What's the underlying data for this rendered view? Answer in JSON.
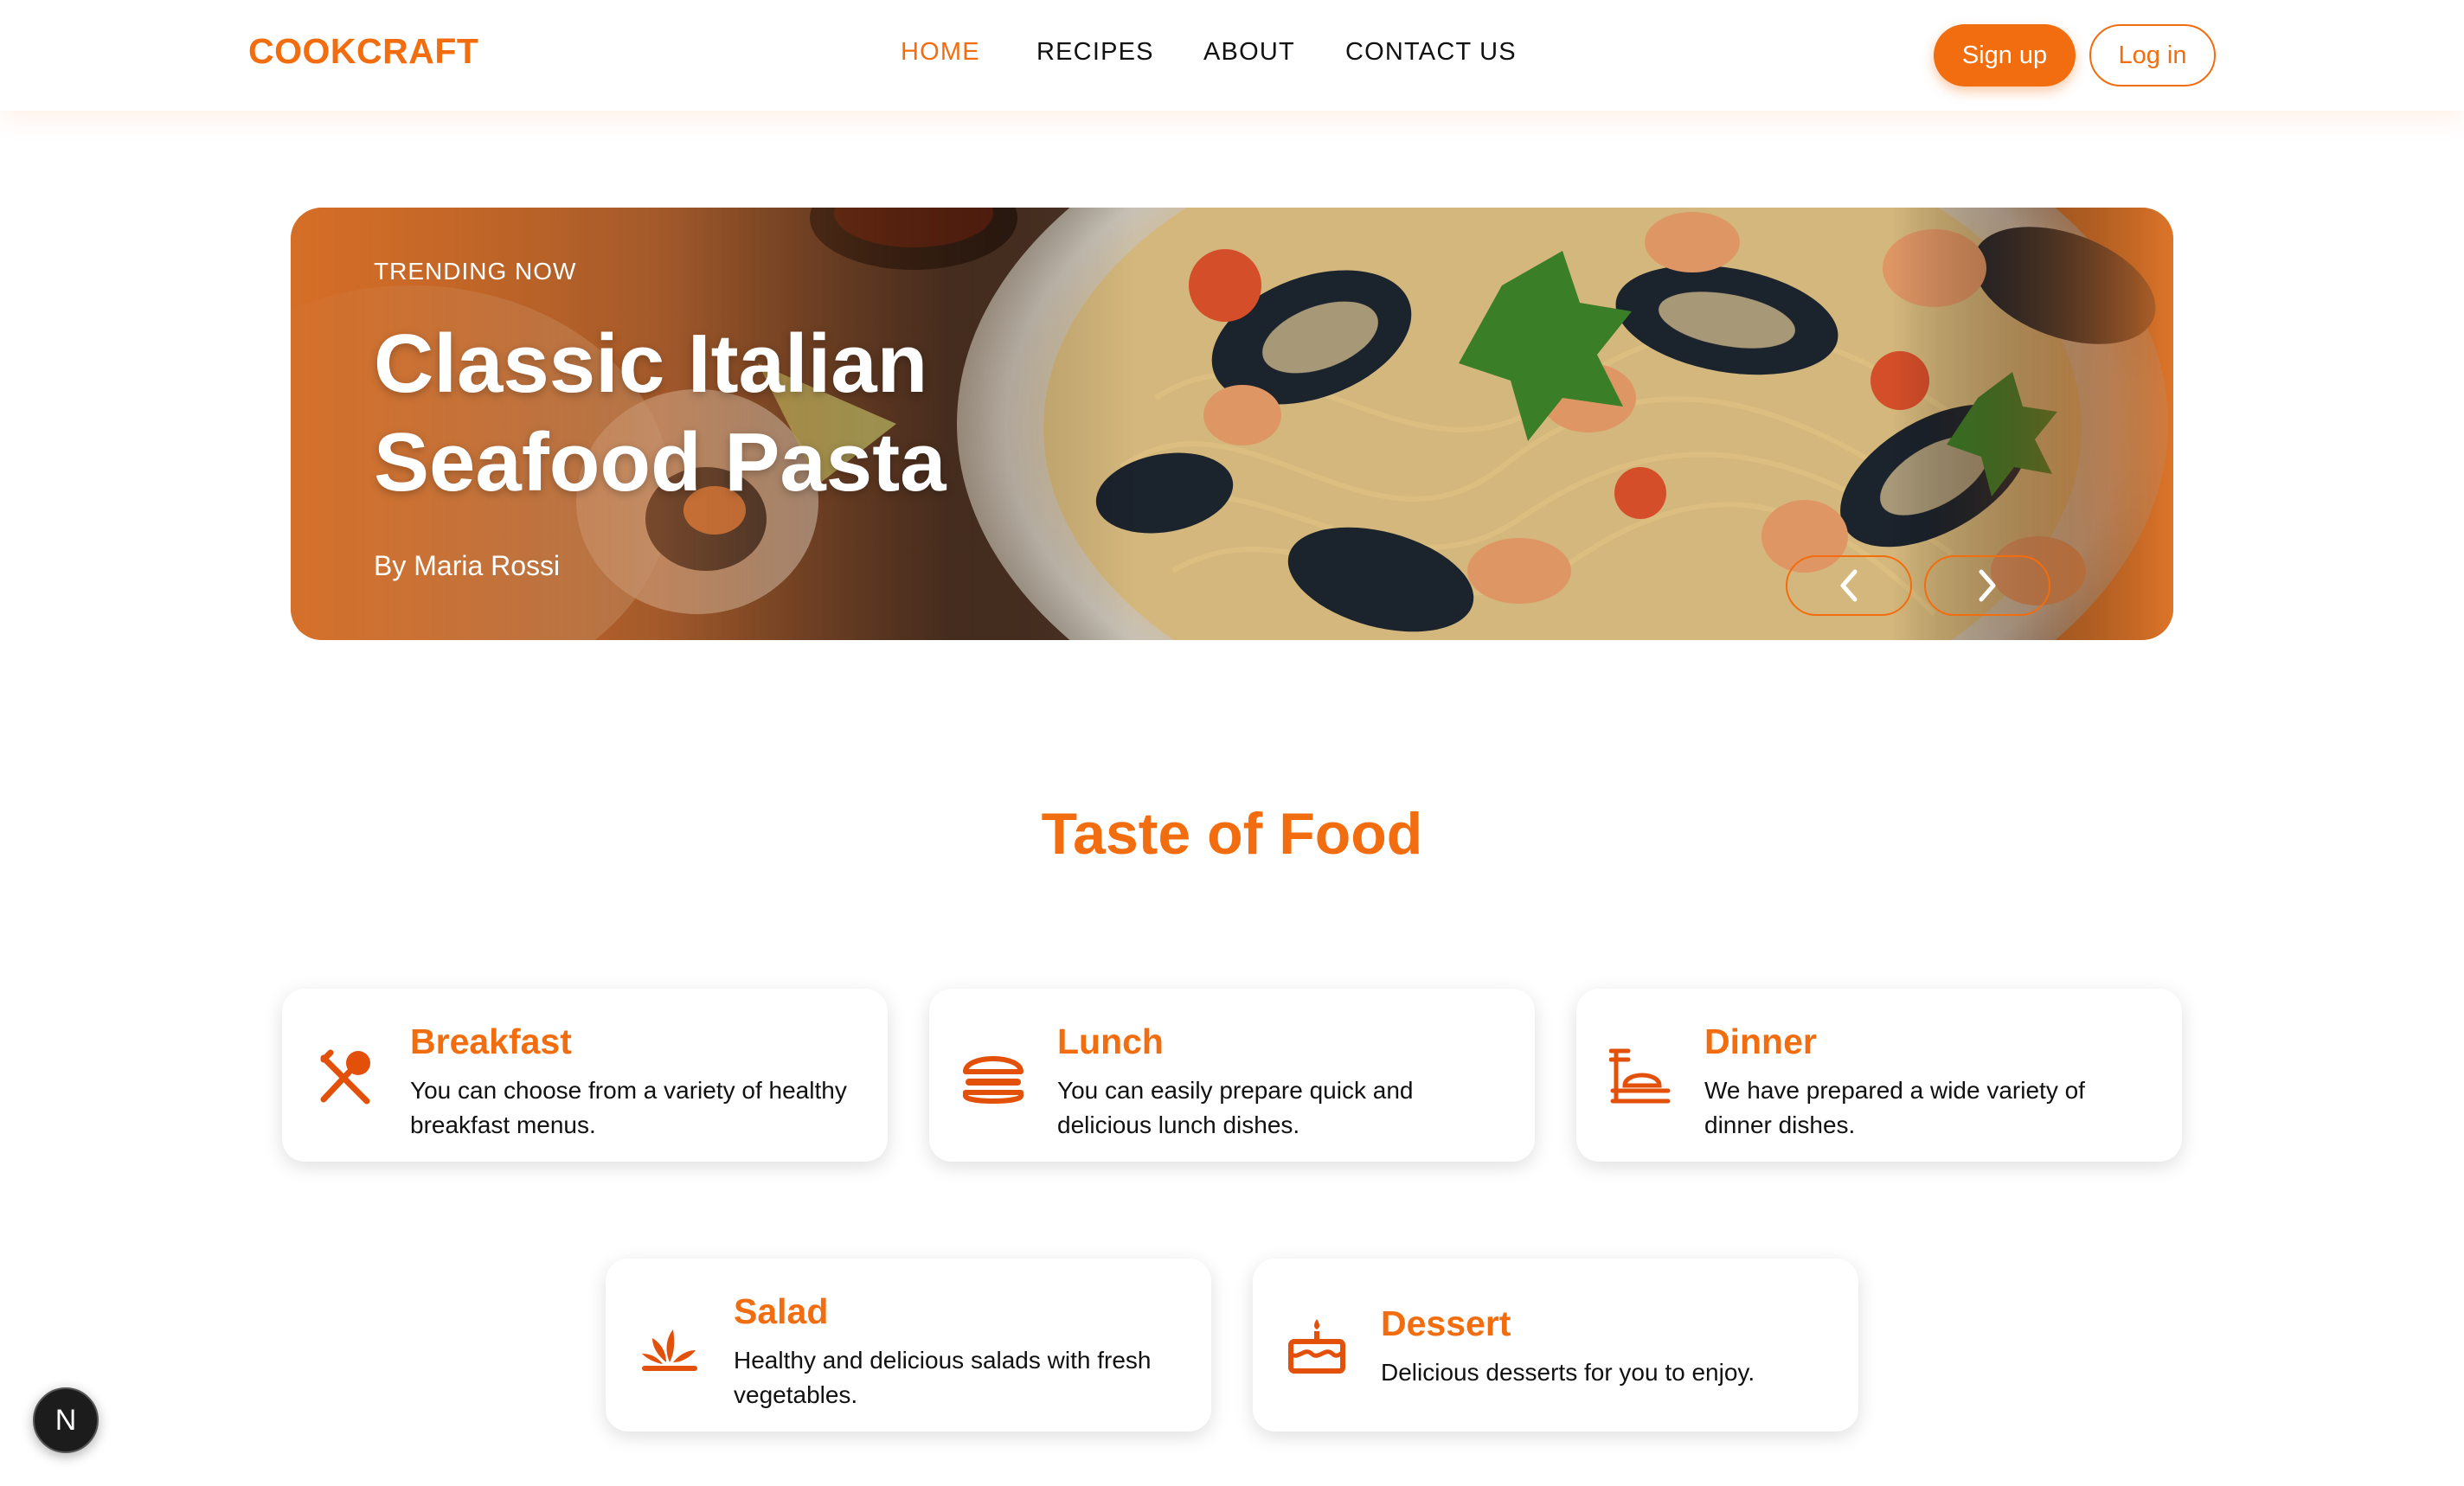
{
  "header": {
    "brand": "COOKCRAFT",
    "nav": [
      {
        "label": "HOME",
        "active": true
      },
      {
        "label": "RECIPES",
        "active": false
      },
      {
        "label": "ABOUT",
        "active": false
      },
      {
        "label": "CONTACT US",
        "active": false
      }
    ],
    "signup_label": "Sign up",
    "login_label": "Log in"
  },
  "hero": {
    "eyebrow": "TRENDING NOW",
    "title_line1": "Classic Italian",
    "title_line2": "Seafood Pasta",
    "author": "By Maria Rossi",
    "prev_icon": "chevron-left-icon",
    "next_icon": "chevron-right-icon"
  },
  "section": {
    "title": "Taste of Food",
    "categories": [
      {
        "title": "Breakfast",
        "text": "You can choose from a variety of healthy breakfast menus.",
        "icon": "fork-spoon-icon"
      },
      {
        "title": "Lunch",
        "text": "You can easily prepare quick and delicious lunch dishes.",
        "icon": "burger-icon"
      },
      {
        "title": "Dinner",
        "text": "We have prepared a wide variety of dinner dishes.",
        "icon": "dinner-plate-icon"
      },
      {
        "title": "Salad",
        "text": "Healthy and delicious salads with fresh vegetables.",
        "icon": "leaf-icon"
      },
      {
        "title": "Dessert",
        "text": "Delicious desserts for you to enjoy.",
        "icon": "cake-icon"
      }
    ]
  },
  "dev_badge": {
    "label": "N"
  },
  "colors": {
    "accent": "#f26d0f",
    "text": "#111111",
    "background": "#ffffff"
  }
}
